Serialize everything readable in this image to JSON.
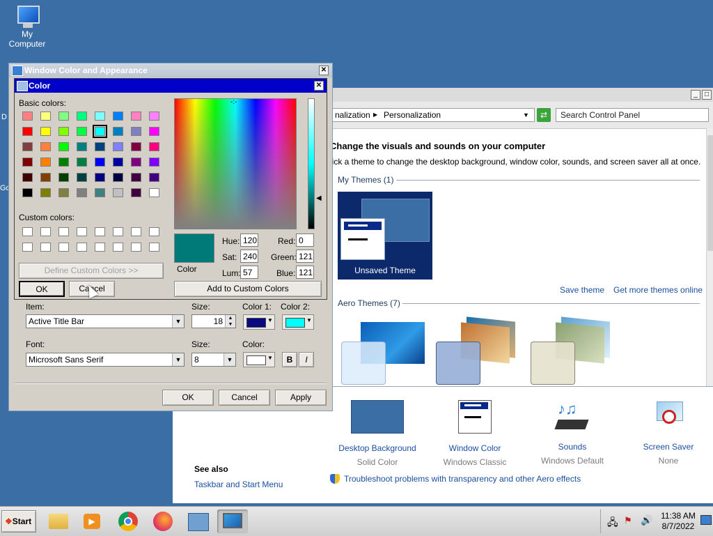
{
  "desktop": {
    "icon_label": "My Computer",
    "edge_labels": [
      "D",
      "Go"
    ]
  },
  "control_panel": {
    "breadcrumb_part1": "nalization",
    "breadcrumb_part2": "Personalization",
    "search_placeholder": "Search Control Panel",
    "heading": "Change the visuals and sounds on your computer",
    "subheading": "lick a theme to change the desktop background, window color, sounds, and screen saver all at once.",
    "my_themes": "My Themes (1)",
    "unsaved_theme": "Unsaved Theme",
    "save_theme": "Save theme",
    "get_more": "Get more themes online",
    "aero_themes": "Aero Themes (7)",
    "bottom_items": [
      {
        "label": "Desktop Background",
        "sub": "Solid Color"
      },
      {
        "label": "Window Color",
        "sub": "Windows Classic"
      },
      {
        "label": "Sounds",
        "sub": "Windows Default"
      },
      {
        "label": "Screen Saver",
        "sub": "None"
      }
    ],
    "see_also": "See also",
    "taskbar_link": "Taskbar and Start Menu",
    "troubleshoot": "Troubleshoot problems with transparency and other Aero effects"
  },
  "wca": {
    "title": "Window Color and Appearance",
    "item_label": "Item:",
    "item_value": "Active Title Bar",
    "size_label": "Size:",
    "size_value": "18",
    "color1_label": "Color 1:",
    "color2_label": "Color 2:",
    "color1": "#0a0a80",
    "color2": "#00ffff",
    "font_label": "Font:",
    "font_value": "Microsoft Sans Serif",
    "font_size_label": "Size:",
    "font_size_value": "8",
    "font_color_label": "Color:",
    "bold": "B",
    "italic": "I",
    "ok": "OK",
    "cancel": "Cancel",
    "apply": "Apply"
  },
  "color_dialog": {
    "title": "Color",
    "basic_colors_label": "Basic colors:",
    "custom_colors_label": "Custom colors:",
    "define_custom": "Define Custom Colors >>",
    "ok": "OK",
    "cancel": "Cancel",
    "add_custom": "Add to Custom Colors",
    "color_solid_label": "Color",
    "hue_label": "Hue:",
    "hue": "120",
    "sat_label": "Sat:",
    "sat": "240",
    "lum_label": "Lum:",
    "lum": "57",
    "red_label": "Red:",
    "red": "0",
    "green_label": "Green:",
    "green": "121",
    "blue_label": "Blue:",
    "blue": "121",
    "current_color": "#007979",
    "basic_colors": [
      "#ff8080",
      "#ffff80",
      "#80ff80",
      "#00ff80",
      "#80ffff",
      "#0080ff",
      "#ff80c0",
      "#ff80ff",
      "#ff0000",
      "#ffff00",
      "#80ff00",
      "#00ff40",
      "#00ffff",
      "#0080c0",
      "#8080c0",
      "#ff00ff",
      "#804040",
      "#ff8040",
      "#00ff00",
      "#008080",
      "#004080",
      "#8080ff",
      "#800040",
      "#ff0080",
      "#800000",
      "#ff8000",
      "#008000",
      "#008040",
      "#0000ff",
      "#0000a0",
      "#800080",
      "#8000ff",
      "#400000",
      "#804000",
      "#004000",
      "#004040",
      "#000080",
      "#000040",
      "#400040",
      "#400080",
      "#000000",
      "#808000",
      "#808040",
      "#808080",
      "#408080",
      "#c0c0c0",
      "#400040",
      "#ffffff"
    ]
  },
  "taskbar": {
    "start": "Start",
    "time": "11:38 AM",
    "date": "8/7/2022"
  }
}
